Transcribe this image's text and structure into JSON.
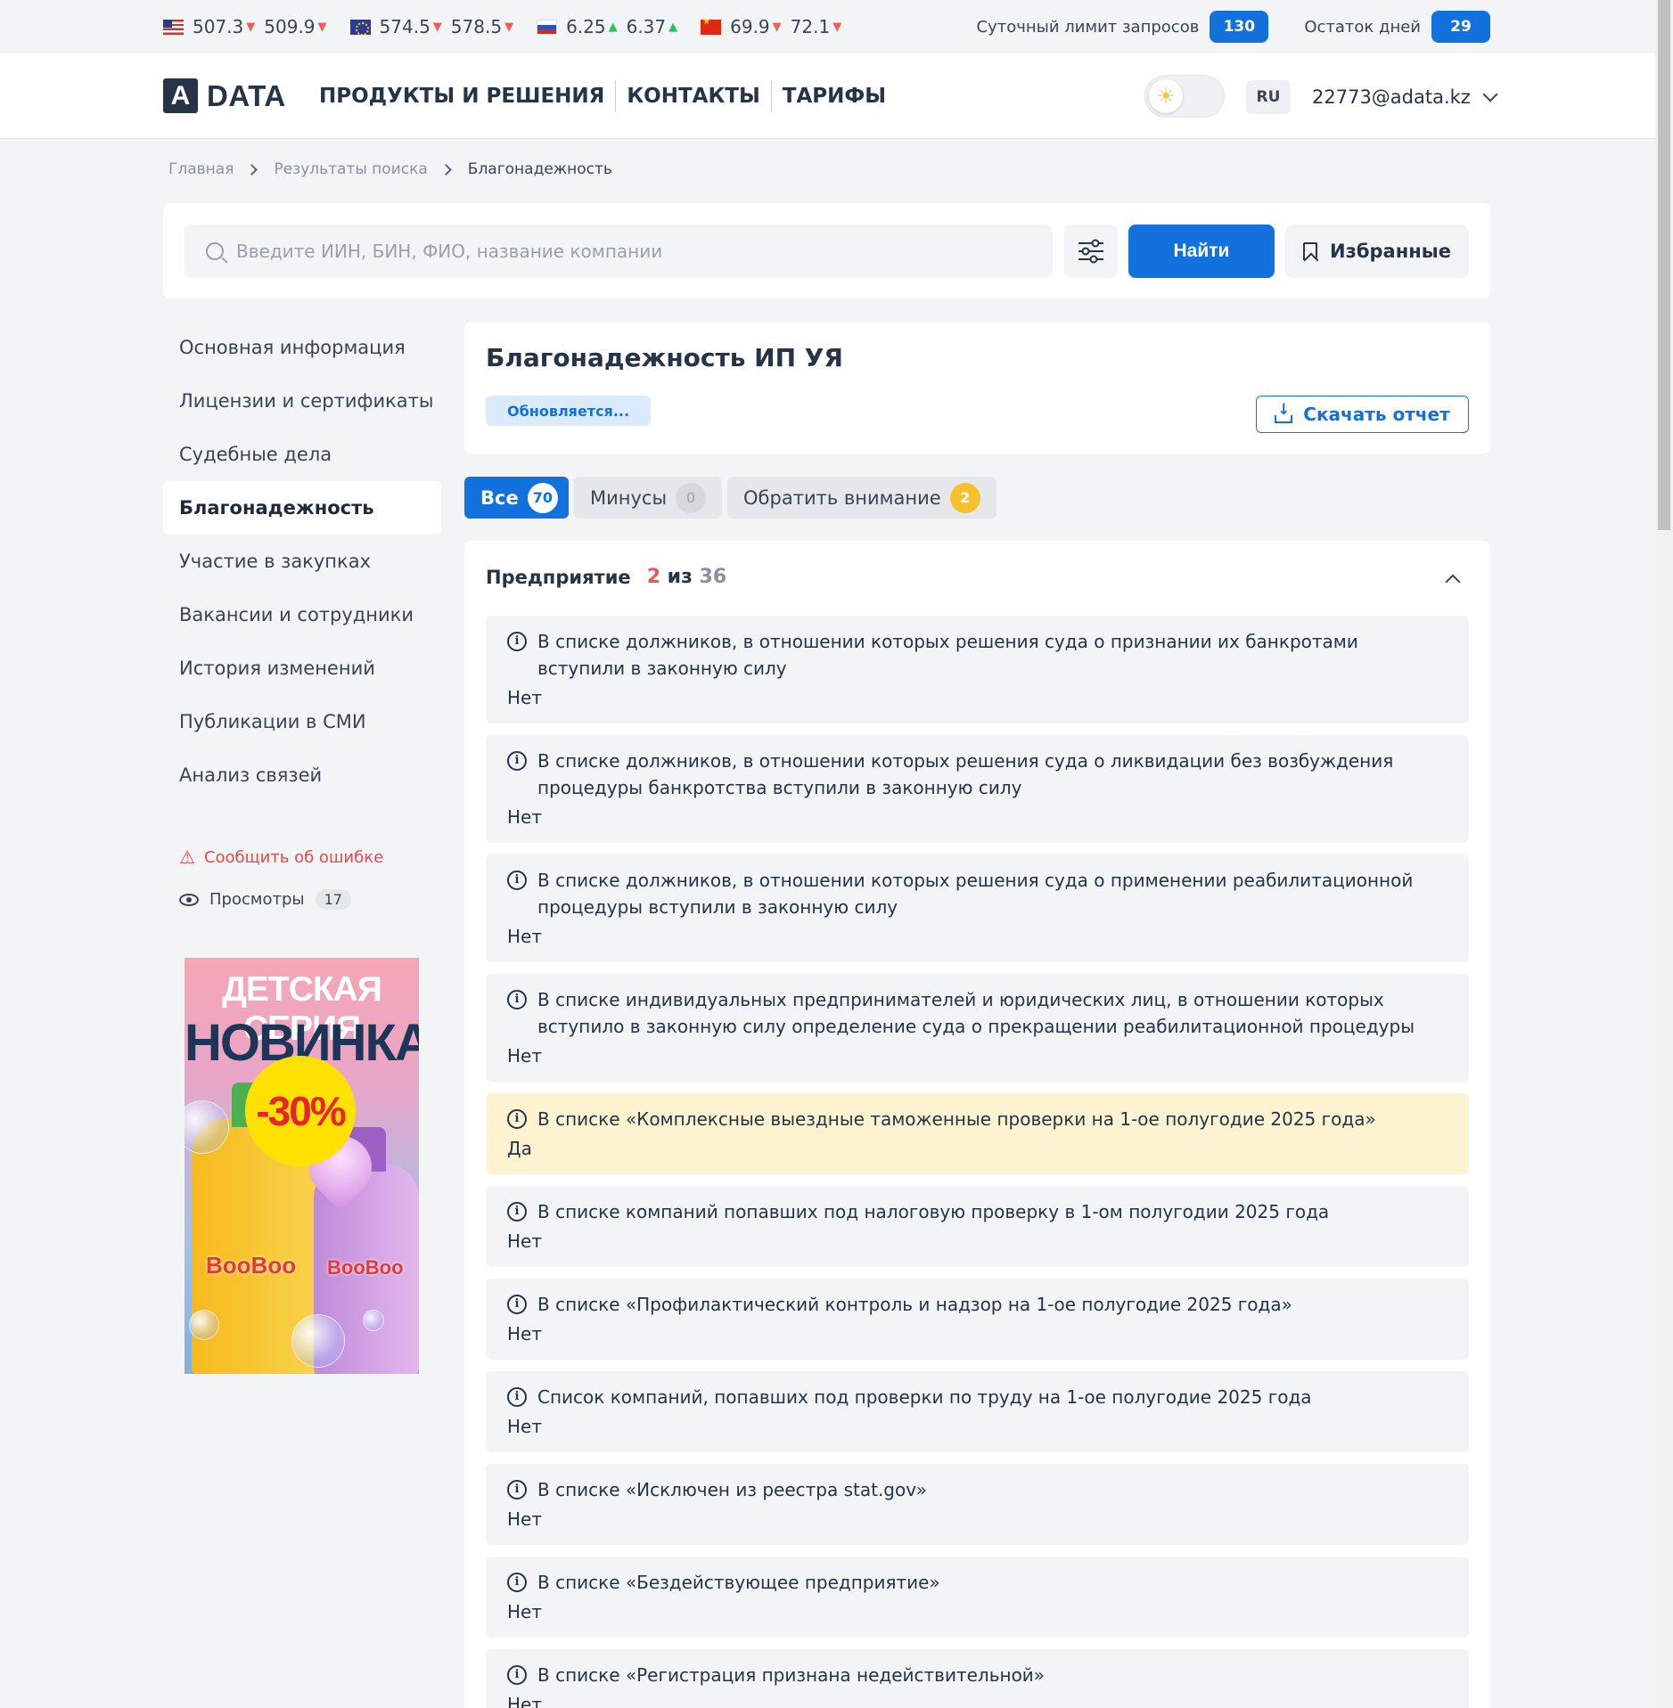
{
  "rates": [
    {
      "flag": "us",
      "buy": "507.3",
      "sell": "509.9",
      "buy_dir": "down",
      "sell_dir": "down"
    },
    {
      "flag": "eu",
      "buy": "574.5",
      "sell": "578.5",
      "buy_dir": "down",
      "sell_dir": "down"
    },
    {
      "flag": "ru",
      "buy": "6.25",
      "sell": "6.37",
      "buy_dir": "up",
      "sell_dir": "up"
    },
    {
      "flag": "cn",
      "buy": "69.9",
      "sell": "72.1",
      "buy_dir": "down",
      "sell_dir": "down"
    }
  ],
  "limits": {
    "daily_label": "Суточный лимит запросов",
    "daily_value": "130",
    "days_label": "Остаток дней",
    "days_value": "29"
  },
  "header": {
    "logo_letter": "A",
    "logo_text": "DATA",
    "nav": [
      "ПРОДУКТЫ И РЕШЕНИЯ",
      "КОНТАКТЫ",
      "ТАРИФЫ"
    ],
    "lang": "RU",
    "user_email": "22773@adata.kz"
  },
  "breadcrumb": [
    "Главная",
    "Результаты поиска",
    "Благонадежность"
  ],
  "search": {
    "placeholder": "Введите ИИН, БИН, ФИО, название компании",
    "find_label": "Найти",
    "favorites_label": "Избранные"
  },
  "sidebar": {
    "items": [
      "Основная информация",
      "Лицензии и сертификаты",
      "Судебные дела",
      "Благонадежность",
      "Участие в закупках",
      "Вакансии и сотрудники",
      "История изменений",
      "Публикации в СМИ",
      "Анализ связей"
    ],
    "report_error": "Сообщить об ошибке",
    "views_label": "Просмотры",
    "views_count": "17"
  },
  "ad": {
    "line1": "ДЕТСКАЯ СЕРИЯ",
    "line2": "НОВИНКА!",
    "sale": "-30%",
    "brand": "BooBoo"
  },
  "main": {
    "title": "Благонадежность ИП УЯ",
    "status": "Обновляется...",
    "download_label": "Скачать отчет",
    "tabs": [
      {
        "label": "Все",
        "count": "70"
      },
      {
        "label": "Минусы",
        "count": "0"
      },
      {
        "label": "Обратить внимание",
        "count": "2"
      }
    ],
    "section": {
      "title": "Предприятие",
      "negatives": "2",
      "of": "из",
      "total": "36"
    },
    "items": [
      {
        "q": "В списке должников, в отношении которых решения суда о признании их банкротами вступили в законную силу",
        "a": "Нет"
      },
      {
        "q": "В списке должников, в отношении которых решения суда о ликвидации без возбуждения процедуры банкротства вступили в законную силу",
        "a": "Нет"
      },
      {
        "q": "В списке должников, в отношении которых решения суда о применении реабилитационной процедуры вступили в законную силу",
        "a": "Нет"
      },
      {
        "q": "В списке индивидуальных предпринимателей и юридических лиц, в отношении которых вступило в законную силу определение суда о прекращении реабилитационной процедуры",
        "a": "Нет"
      },
      {
        "q": "В списке «Комплексные выездные таможенные проверки на 1-ое полугодие 2025 года»",
        "a": "Да"
      },
      {
        "q": "В списке компаний попавших под налоговую проверку в 1-ом полугодии 2025 года",
        "a": "Нет"
      },
      {
        "q": "В списке «Профилактический контроль и надзор на 1-ое полугодие 2025 года»",
        "a": "Нет"
      },
      {
        "q": "Список компаний, попавших под проверки по труду на 1-ое полугодие 2025 года",
        "a": "Нет"
      },
      {
        "q": "В списке «Исключен из реестра stat.gov»",
        "a": "Нет"
      },
      {
        "q": "В списке «Бездействующее предприятие»",
        "a": "Нет"
      },
      {
        "q": "В списке «Регистрация признана недействительной»",
        "a": "Нет"
      }
    ]
  }
}
